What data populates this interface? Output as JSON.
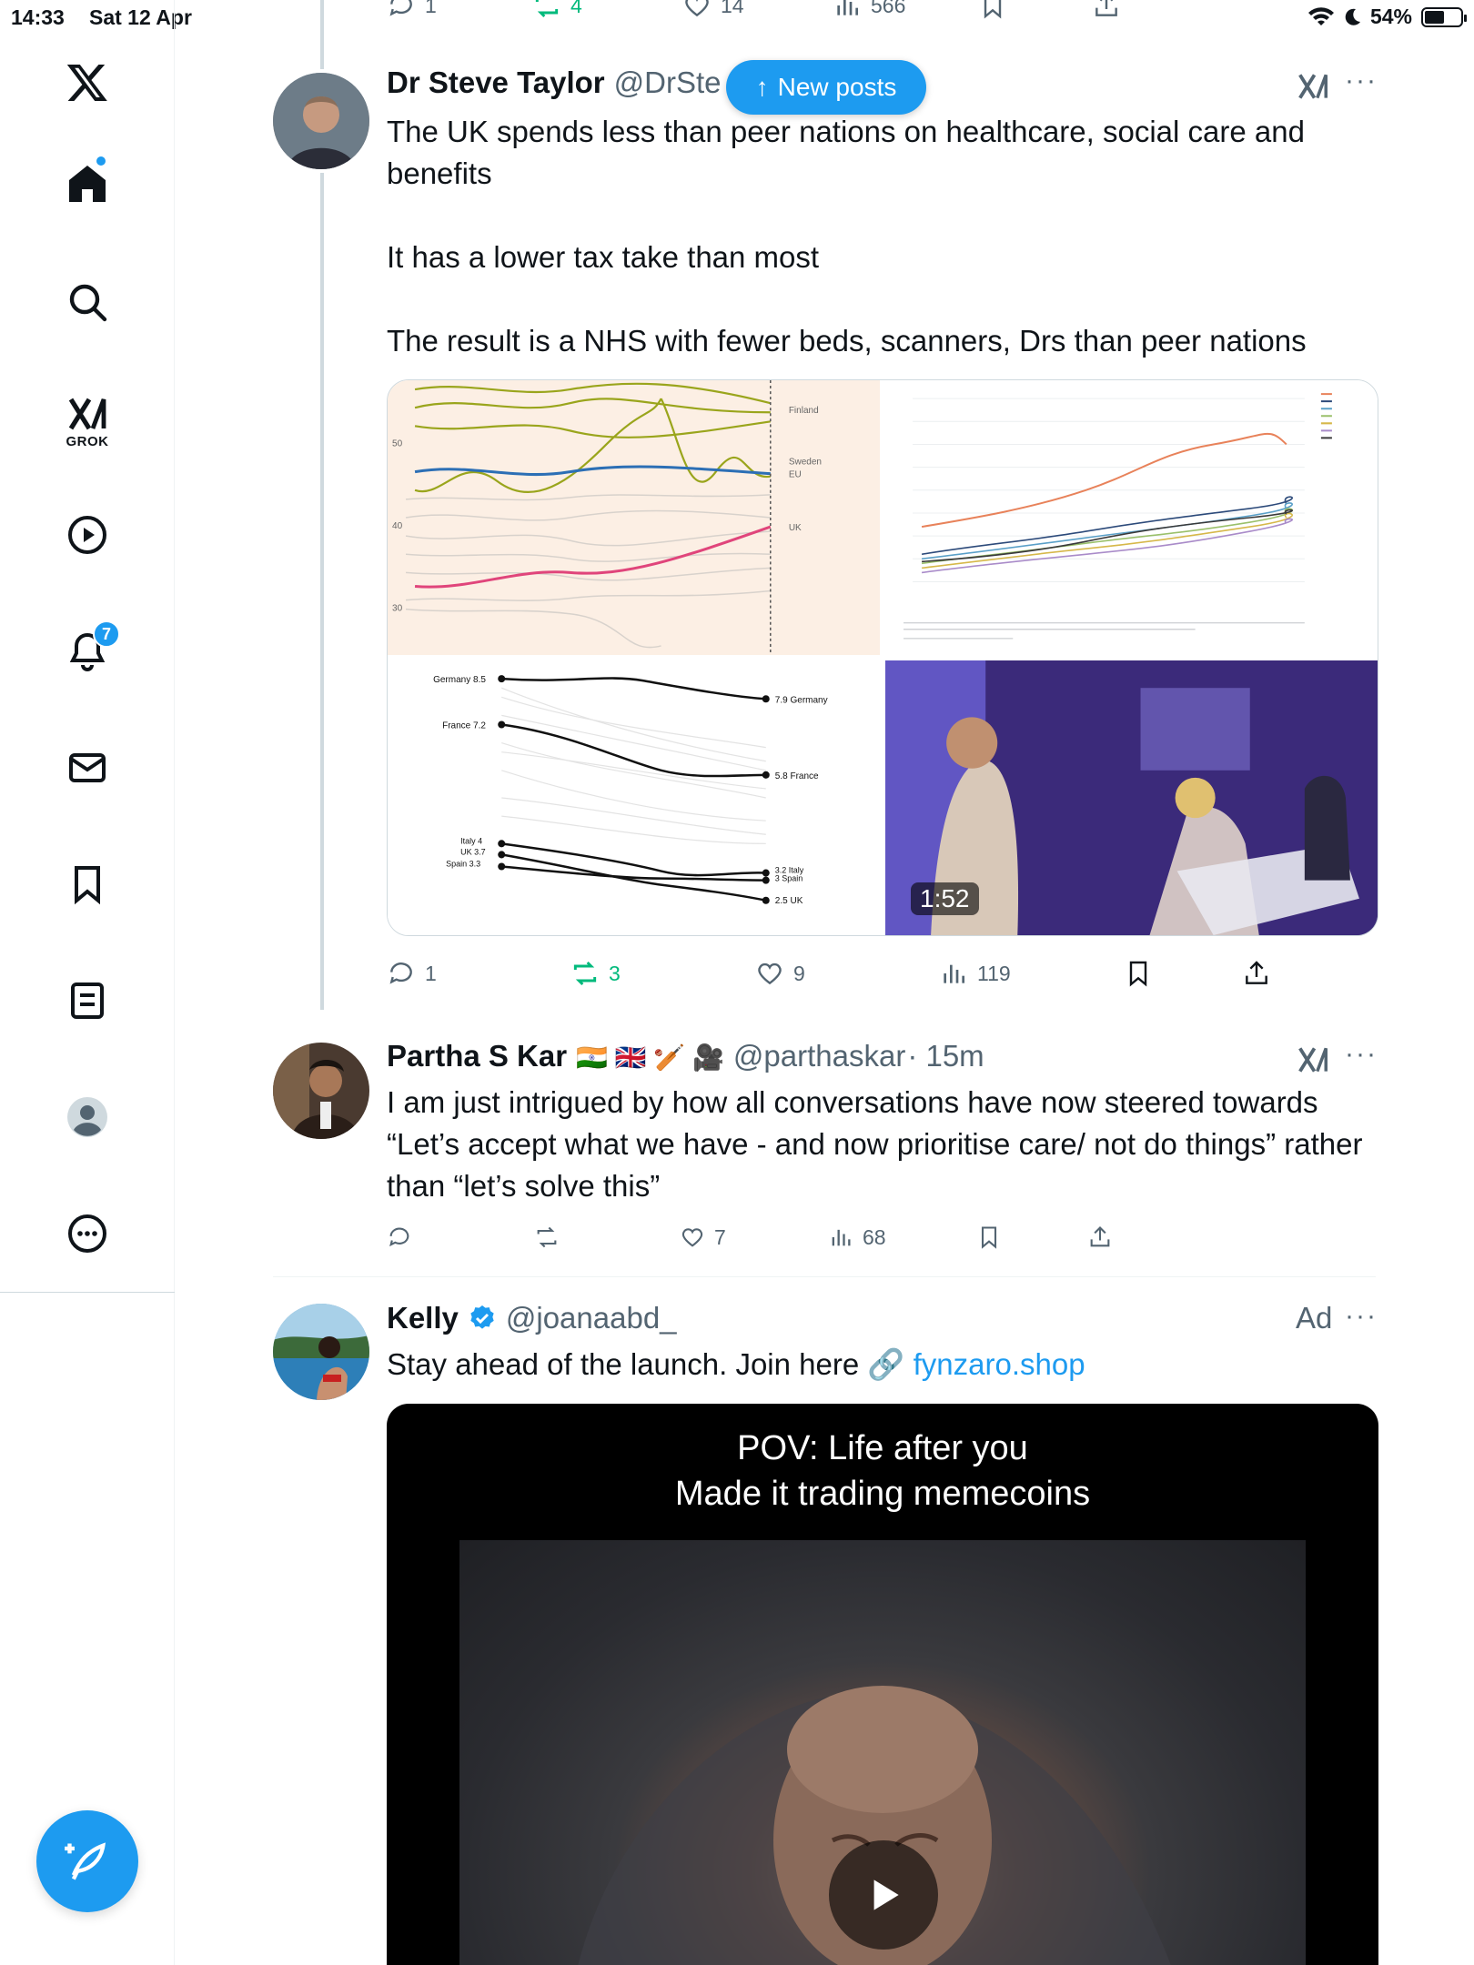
{
  "status_bar": {
    "time": "14:33",
    "date": "Sat 12 Apr",
    "battery": "54%",
    "battery_level": 0.54
  },
  "sidebar": {
    "grok_label": "GROK",
    "notifications_badge": "7"
  },
  "new_posts_label": "New posts",
  "prev_tweet_actions": {
    "replies": "1",
    "reposts": "4",
    "likes": "14",
    "views": "566"
  },
  "tweet1": {
    "name": "Dr Steve Taylor",
    "handle": "@DrSte",
    "text_p1": "The UK spends less than peer nations on healthcare, social care and benefits",
    "text_p2": "It has a lower tax take than most",
    "text_p3": "The result is a NHS with fewer beds, scanners, Drs than peer nations",
    "video_duration": "1:52",
    "replies": "1",
    "reposts": "3",
    "likes": "9",
    "views": "119",
    "chart_a_labels": {
      "finland": "Finland",
      "sweden": "Sweden",
      "eu": "EU",
      "uk": "UK",
      "y50": "50",
      "y40": "40",
      "y30": "30"
    },
    "chart_c_labels": {
      "germany_l": "Germany 8.5",
      "france_l": "France 7.2",
      "italy_l": "Italy 4",
      "uk_l": "UK 3.7",
      "spain_l": "Spain 3.3",
      "germany_r": "7.9 Germany",
      "france_r": "5.8 France",
      "italy_r": "3.2 Italy",
      "spain_r": "3 Spain",
      "uk_r": "2.5 UK"
    }
  },
  "tweet2": {
    "name": "Partha S Kar",
    "emojis": "🇮🇳 🇬🇧 🏏 🎥",
    "handle": "@parthaskar",
    "time": "· 15m",
    "text": "I am just intrigued by how all conversations have now steered towards “Let’s accept what we have - and now prioritise care/ not do things” rather than “let’s solve this”",
    "replies": "",
    "reposts": "",
    "likes": "7",
    "views": "68"
  },
  "tweet3": {
    "name": "Kelly",
    "handle": "@joanaabd_",
    "ad_label": "Ad",
    "text": "Stay ahead of the launch. Join here 🔗 ",
    "link": "fynzaro.shop",
    "ad_caption_l1": "POV: Life after you",
    "ad_caption_l2": "Made it trading memecoins"
  },
  "colors": {
    "accent": "#1d9bf0",
    "repost_green": "#00ba7c",
    "text": "#0f1419",
    "muted": "#536471"
  }
}
